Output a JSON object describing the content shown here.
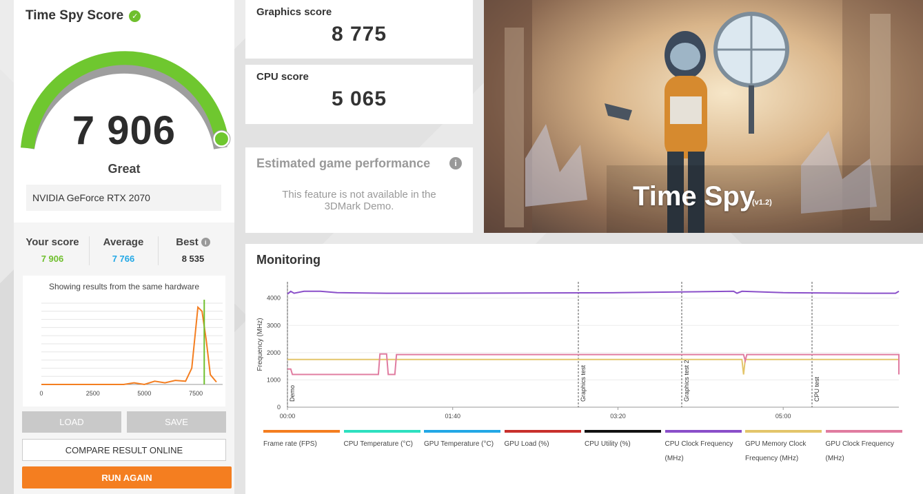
{
  "score_panel": {
    "title": "Time Spy Score",
    "score": "7 906",
    "rating": "Great",
    "hardware": "NVIDIA GeForce RTX 2070",
    "gauge_fraction": 0.97,
    "stats": {
      "your_label": "Your score",
      "your_value": "7 906",
      "avg_label": "Average",
      "avg_value": "7 766",
      "best_label": "Best",
      "best_value": "8 535"
    },
    "distribution_caption": "Showing results from the same hardware",
    "distribution_ticks": [
      "0",
      "2500",
      "5000",
      "7500"
    ],
    "buttons": {
      "load": "LOAD",
      "save": "SAVE",
      "compare": "COMPARE RESULT ONLINE",
      "run_again": "RUN AGAIN"
    }
  },
  "graphics": {
    "title": "Graphics score",
    "value": "8 775"
  },
  "cpu": {
    "title": "CPU score",
    "value": "5 065"
  },
  "estimated": {
    "title": "Estimated game performance",
    "message_line1": "This feature is not available in the",
    "message_line2": "3DMark Demo."
  },
  "hero": {
    "title": "Time Spy",
    "version": "(v1.2)"
  },
  "monitoring": {
    "title": "Monitoring",
    "ylabel": "Frequency (MHz)",
    "y_ticks": [
      "0",
      "1000",
      "2000",
      "3000",
      "4000"
    ],
    "x_ticks": [
      "00:00",
      "01:40",
      "03:20",
      "05:00"
    ],
    "markers": [
      "Demo",
      "Graphics test",
      "Graphics test 2",
      "CPU test"
    ],
    "legend": [
      {
        "label": "Frame rate (FPS)",
        "color": "#f47e20"
      },
      {
        "label": "CPU Temperature (°C)",
        "color": "#2de0c0"
      },
      {
        "label": "GPU Temperature (°C)",
        "color": "#22a8e6"
      },
      {
        "label": "GPU Load (%)",
        "color": "#c8302c"
      },
      {
        "label": "CPU Utility (%)",
        "color": "#111111"
      },
      {
        "label": "CPU Clock Frequency (MHz)",
        "color": "#8a4fc9"
      },
      {
        "label": "GPU Memory Clock Frequency (MHz)",
        "color": "#e3c56a"
      },
      {
        "label": "GPU Clock Frequency (MHz)",
        "color": "#e07ca0"
      }
    ]
  },
  "chart_data": [
    {
      "type": "line",
      "title": "",
      "x": [
        0,
        1000,
        2000,
        3000,
        4000,
        4500,
        5000,
        5500,
        6000,
        6500,
        7000,
        7300,
        7600,
        7800,
        8000,
        8200,
        8500
      ],
      "series": [
        {
          "name": "",
          "values": [
            0,
            0,
            0,
            0,
            0,
            2,
            0,
            4,
            2,
            5,
            4,
            20,
            95,
            90,
            55,
            12,
            3
          ]
        }
      ],
      "xlim": [
        0,
        8800
      ],
      "x_ticks": [
        0,
        2500,
        5000,
        7500
      ],
      "your_score_marker": 7906
    },
    {
      "type": "line",
      "ylabel": "Frequency (MHz)",
      "ylim": [
        0,
        4600
      ],
      "x_range_sec": [
        0,
        370
      ],
      "series": [
        {
          "name": "CPU Clock Frequency (MHz)",
          "color": "#8a4fc9",
          "x": [
            0,
            2,
            4,
            10,
            20,
            30,
            60,
            100,
            200,
            270,
            272,
            275,
            300,
            350,
            368,
            370
          ],
          "values": [
            4150,
            4250,
            4180,
            4250,
            4250,
            4200,
            4180,
            4180,
            4200,
            4250,
            4180,
            4250,
            4200,
            4180,
            4180,
            4250
          ]
        },
        {
          "name": "GPU Memory Clock Frequency (MHz)",
          "color": "#e3c56a",
          "x": [
            0,
            275,
            276,
            277,
            278,
            370
          ],
          "values": [
            1750,
            1750,
            1200,
            1750,
            1750,
            1750
          ]
        },
        {
          "name": "GPU Clock Frequency (MHz)",
          "color": "#e07ca0",
          "x": [
            0,
            2,
            3,
            55,
            56,
            60,
            61,
            65,
            66,
            276,
            277,
            278,
            500,
            498,
            499,
            500,
            560
          ],
          "values": [
            1400,
            1400,
            1200,
            1200,
            1950,
            1950,
            1200,
            1200,
            1930,
            1930,
            1700,
            1930,
            1930,
            1900,
            1200,
            1200,
            1200
          ]
        }
      ]
    }
  ]
}
